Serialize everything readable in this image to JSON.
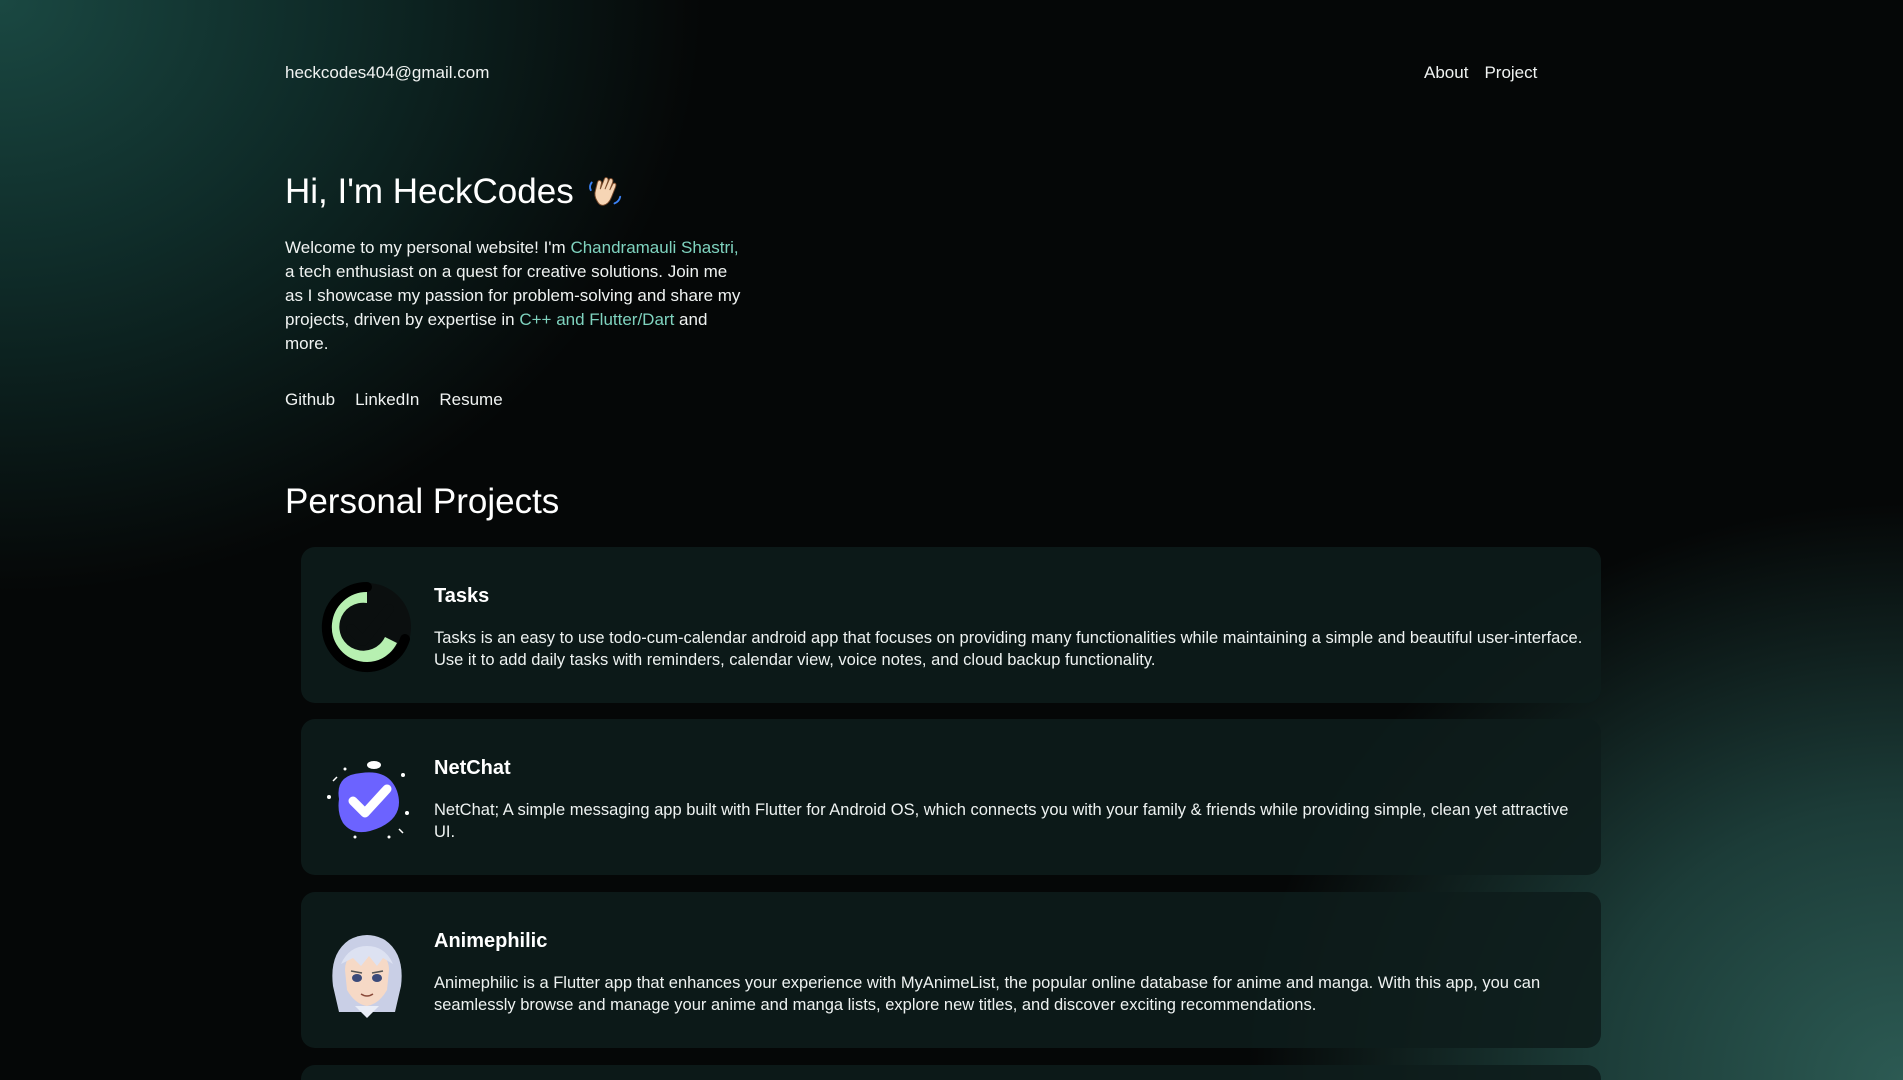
{
  "header": {
    "email": "heckcodes404@gmail.com",
    "nav": [
      "About",
      "Project"
    ]
  },
  "hero": {
    "title": "Hi, I'm HeckCodes",
    "title_icon": "waving-hand-icon",
    "intro": {
      "part1": "Welcome to my personal website! I'm ",
      "name": "Chandramauli Shastri,",
      "part2": " a tech enthusiast on a quest for creative solutions. Join me as I showcase my passion for problem-solving and share my projects, driven by expertise in ",
      "skills": "C++ and Flutter/Dart",
      "part3": " and more."
    },
    "links": [
      "Github",
      "LinkedIn",
      "Resume"
    ]
  },
  "projects": {
    "title": "Personal Projects",
    "items": [
      {
        "name": "Tasks",
        "icon": "tasks-checkmark-icon",
        "description": "Tasks is an easy to use todo-cum-calendar android app that focuses on providing many functionalities while maintaining a simple and beautiful user-interface. Use it to add daily tasks with reminders, calendar view, voice notes, and cloud backup functionality."
      },
      {
        "name": "NetChat",
        "icon": "netchat-check-blob-icon",
        "description": "NetChat; A simple messaging app built with Flutter for Android OS, which connects you with your family & friends while providing simple, clean yet attractive UI."
      },
      {
        "name": "Animephilic",
        "icon": "anime-avatar-icon",
        "description": "Animephilic is a Flutter app that enhances your experience with MyAnimeList, the popular online database for anime and manga. With this app, you can seamlessly browse and manage your anime and manga lists, explore new titles, and discover exciting recommendations."
      }
    ]
  },
  "colors": {
    "background": "#050707",
    "accent": "#7fd3bf",
    "card": "#0e1c1b",
    "tasks_green": "#b7f0b1",
    "netchat_purple": "#6c63ff"
  }
}
